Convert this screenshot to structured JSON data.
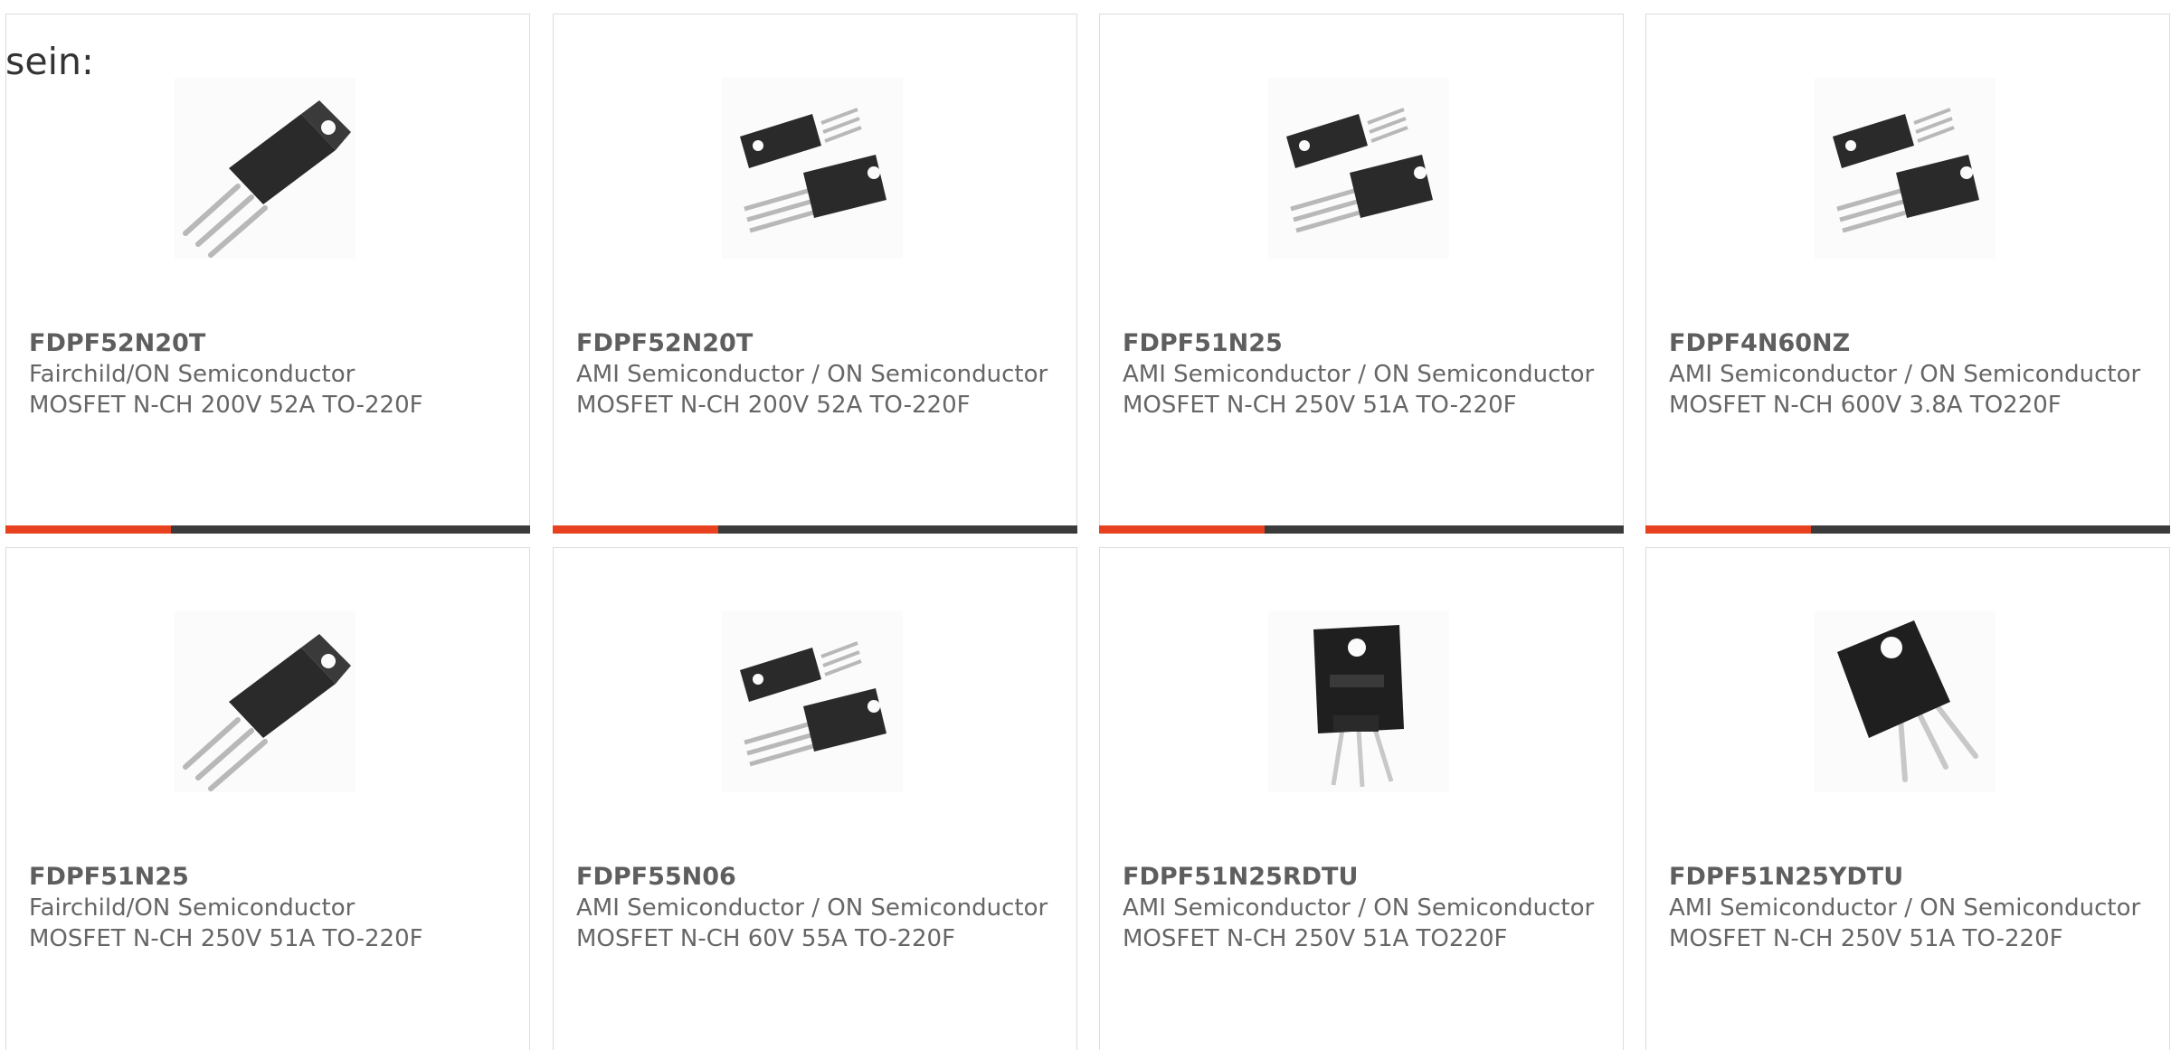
{
  "intro_text": "sein:",
  "colors": {
    "accent": "#e8411f",
    "bar": "#3b3b3b",
    "text": "#666666",
    "border": "#dcdcdc"
  },
  "products": [
    {
      "part": "FDPF52N20T",
      "manufacturer": "Fairchild/ON Semiconductor",
      "description": "MOSFET N-CH 200V 52A TO-220F",
      "image": "to220f-single-icon"
    },
    {
      "part": "FDPF52N20T",
      "manufacturer": "AMI Semiconductor / ON Semiconductor",
      "description": "MOSFET N-CH 200V 52A TO-220F",
      "image": "to220f-pair-icon"
    },
    {
      "part": "FDPF51N25",
      "manufacturer": "AMI Semiconductor / ON Semiconductor",
      "description": "MOSFET N-CH 250V 51A TO-220F",
      "image": "to220f-pair-icon"
    },
    {
      "part": "FDPF4N60NZ",
      "manufacturer": "AMI Semiconductor / ON Semiconductor",
      "description": "MOSFET N-CH 600V 3.8A TO220F",
      "image": "to220f-pair-icon"
    },
    {
      "part": "FDPF51N25",
      "manufacturer": "Fairchild/ON Semiconductor",
      "description": "MOSFET N-CH 250V 51A TO-220F",
      "image": "to220f-single-icon"
    },
    {
      "part": "FDPF55N06",
      "manufacturer": "AMI Semiconductor / ON Semiconductor",
      "description": "MOSFET N-CH 60V 55A TO-220F",
      "image": "to220f-pair-icon"
    },
    {
      "part": "FDPF51N25RDTU",
      "manufacturer": "AMI Semiconductor / ON Semiconductor",
      "description": "MOSFET N-CH 250V 51A TO220F",
      "image": "to220f-front-icon"
    },
    {
      "part": "FDPF51N25YDTU",
      "manufacturer": "AMI Semiconductor / ON Semiconductor",
      "description": "MOSFET N-CH 250V 51A TO-220F",
      "image": "to220f-angled-icon"
    }
  ]
}
